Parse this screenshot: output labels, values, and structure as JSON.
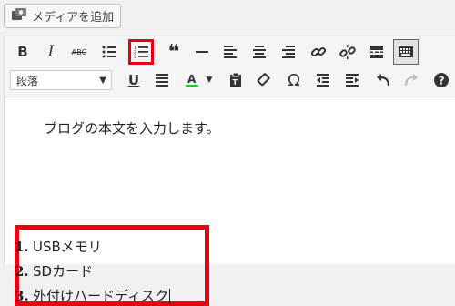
{
  "media_button": {
    "label": "メディアを追加",
    "icon": "media-camera-icon"
  },
  "toolbar": {
    "format_select": {
      "value": "段落"
    },
    "row1": [
      {
        "name": "bold-button",
        "icon": "bold-icon",
        "glyph": "B"
      },
      {
        "name": "italic-button",
        "icon": "italic-icon",
        "glyph": "I"
      },
      {
        "name": "strikethrough-button",
        "icon": "strikethrough-icon",
        "glyph": "ABC"
      },
      {
        "name": "bulleted-list-button",
        "icon": "bulleted-list-icon"
      },
      {
        "name": "numbered-list-button",
        "icon": "numbered-list-icon",
        "highlighted": true
      },
      {
        "name": "blockquote-button",
        "icon": "blockquote-icon",
        "glyph": "❝"
      },
      {
        "name": "horizontal-line-button",
        "icon": "horizontal-line-icon"
      },
      {
        "name": "align-left-button",
        "icon": "align-left-icon"
      },
      {
        "name": "align-center-button",
        "icon": "align-center-icon"
      },
      {
        "name": "align-right-button",
        "icon": "align-right-icon"
      },
      {
        "name": "insert-link-button",
        "icon": "link-icon"
      },
      {
        "name": "remove-link-button",
        "icon": "unlink-icon"
      },
      {
        "name": "read-more-button",
        "icon": "read-more-icon"
      },
      {
        "name": "toolbar-toggle-button",
        "icon": "keyboard-icon",
        "pressed": true
      }
    ],
    "row2": [
      {
        "name": "underline-button",
        "icon": "underline-icon",
        "glyph": "U"
      },
      {
        "name": "justify-button",
        "icon": "justify-icon"
      },
      {
        "name": "text-color-button",
        "icon": "text-color-icon",
        "glyph": "A",
        "accent": "#1dce2a"
      },
      {
        "name": "paste-as-text-button",
        "icon": "clipboard-icon"
      },
      {
        "name": "clear-formatting-button",
        "icon": "eraser-icon"
      },
      {
        "name": "special-character-button",
        "icon": "omega-icon",
        "glyph": "Ω"
      },
      {
        "name": "outdent-button",
        "icon": "outdent-icon"
      },
      {
        "name": "indent-button",
        "icon": "indent-icon"
      },
      {
        "name": "undo-button",
        "icon": "undo-icon"
      },
      {
        "name": "redo-button",
        "icon": "redo-icon",
        "disabled": true
      },
      {
        "name": "help-button",
        "icon": "help-icon",
        "glyph": "?"
      }
    ]
  },
  "content": {
    "paragraph": "ブログの本文を入力します。",
    "list": [
      {
        "num": "1.",
        "text": "USBメモリ"
      },
      {
        "num": "2.",
        "text": "SDカード"
      },
      {
        "num": "3.",
        "text": "外付けハードディスク"
      }
    ]
  },
  "colors": {
    "highlight": "#e50012",
    "text_color_bar": "#1dce2a"
  }
}
